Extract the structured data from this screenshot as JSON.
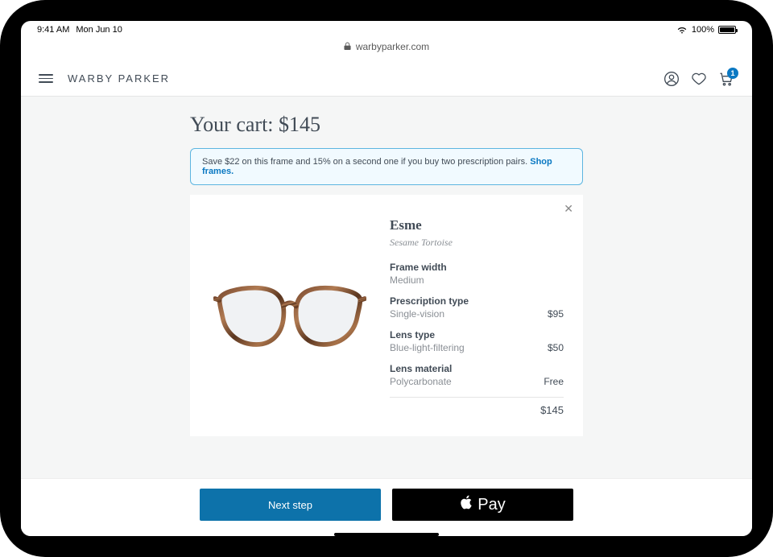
{
  "status": {
    "time": "9:41 AM",
    "date": "Mon Jun 10",
    "battery": "100%"
  },
  "url": "warbyparker.com",
  "brand": "WARBY PARKER",
  "cart_badge": "1",
  "cart": {
    "title": "Your cart: $145",
    "promo_text": "Save $22 on this frame and 15% on a second one if you buy two prescription pairs. ",
    "promo_link": "Shop frames.",
    "item": {
      "name": "Esme",
      "color": "Sesame Tortoise",
      "specs": {
        "frame_width_label": "Frame width",
        "frame_width_value": "Medium",
        "rx_label": "Prescription type",
        "rx_value": "Single-vision",
        "rx_price": "$95",
        "lens_type_label": "Lens type",
        "lens_type_value": "Blue-light-filtering",
        "lens_type_price": "$50",
        "lens_mat_label": "Lens material",
        "lens_mat_value": "Polycarbonate",
        "lens_mat_price": "Free"
      },
      "total": "$145"
    }
  },
  "buttons": {
    "next": "Next step",
    "apple_pay": "Pay"
  }
}
